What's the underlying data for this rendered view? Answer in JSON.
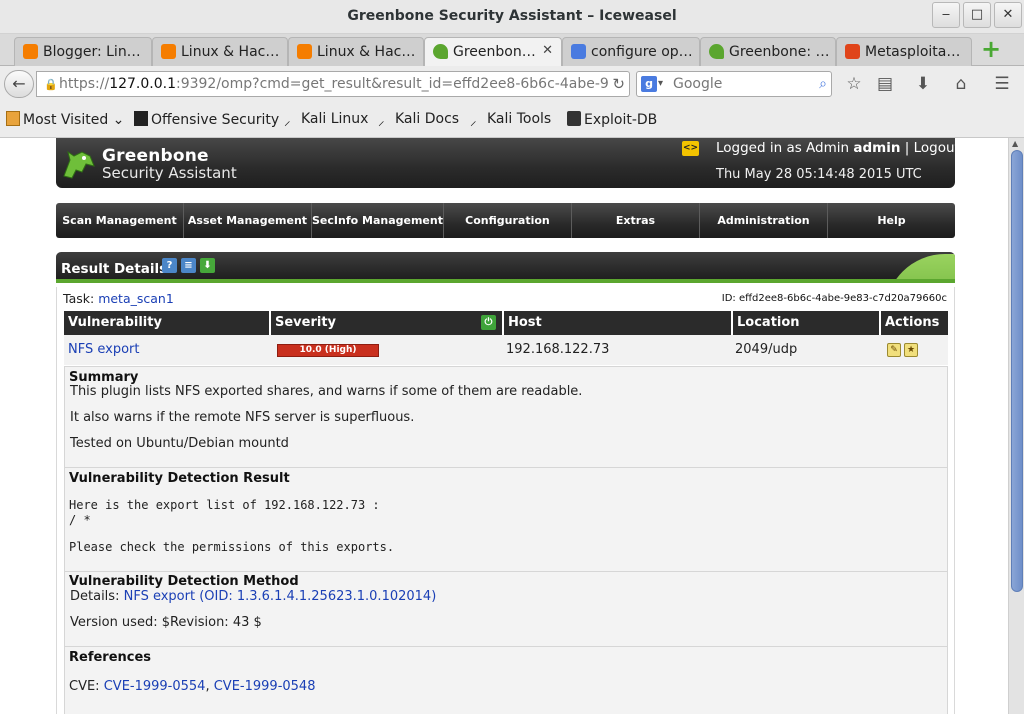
{
  "window": {
    "title": "Greenbone Security Assistant – Iceweasel"
  },
  "tabs": [
    {
      "label": "Blogger: Lin…",
      "icon_color": "#f57d00"
    },
    {
      "label": "Linux & Hac…",
      "icon_color": "#f57d00"
    },
    {
      "label": "Linux & Hac…",
      "icon_color": "#f57d00"
    },
    {
      "label": "Greenbon…",
      "icon_color": "#5ba62f"
    },
    {
      "label": "configure op…",
      "icon_color": "#4a7be0"
    },
    {
      "label": "Greenbone: …",
      "icon_color": "#5ba62f"
    },
    {
      "label": "Metasploita…",
      "icon_color": "#e0441a"
    }
  ],
  "tab_close": "✕",
  "nav": {
    "url_prefix": "https://",
    "url_host": "127.0.0.1",
    "url_rest": ":9392/omp?cmd=get_result&result_id=effd2ee8-6b6c-4abe-9",
    "search_placeholder": "Google"
  },
  "bookmarks": [
    {
      "label": "Most Visited",
      "icon": "folder-icon"
    },
    {
      "label": "Offensive Security",
      "icon": "offsec-icon"
    },
    {
      "label": "Kali Linux",
      "icon": "kali-dragon-icon"
    },
    {
      "label": "Kali Docs",
      "icon": "kali-dragon-icon"
    },
    {
      "label": "Kali Tools",
      "icon": "kali-dragon-icon"
    },
    {
      "label": "Exploit-DB",
      "icon": "exploitdb-icon"
    }
  ],
  "gsa": {
    "brand_line1": "Greenbone",
    "brand_line2": "Security Assistant",
    "lang_icon": "<>",
    "logged_in_prefix": "Logged in as Admin",
    "username": "admin",
    "separator": "|",
    "logout": "Logout",
    "datetime": "Thu May 28 05:14:48 2015 UTC"
  },
  "menu": [
    "Scan Management",
    "Asset Management",
    "SecInfo Management",
    "Configuration",
    "Extras",
    "Administration",
    "Help"
  ],
  "panel": {
    "title": "Result Details",
    "task_label": "Task:",
    "task_name": "meta_scan1",
    "id_label": "ID:",
    "id_value": "effd2ee8-6b6c-4abe-9e83-c7d20a79660c"
  },
  "result_table": {
    "headers": [
      "Vulnerability",
      "Severity",
      "Host",
      "Location",
      "Actions"
    ],
    "row": {
      "vulnerability": "NFS export",
      "severity": "10.0 (High)",
      "host": "192.168.122.73",
      "location": "2049/udp"
    }
  },
  "summary": {
    "title": "Summary",
    "line1": "This plugin lists NFS exported shares, and warns if some of them are readable.",
    "line2": "It also warns if the remote NFS server is superfluous.",
    "line3": "Tested on Ubuntu/Debian mountd"
  },
  "detection_result": {
    "title": "Vulnerability Detection Result",
    "line1": "Here is the export list of 192.168.122.73 :",
    "line2": "/ *",
    "line3": "Please check the permissions of this exports."
  },
  "detection_method": {
    "title": "Vulnerability Detection Method",
    "details_label": "Details:",
    "details_link": "NFS export (OID: 1.3.6.1.4.1.25623.1.0.102014)",
    "version": "Version used: $Revision: 43 $"
  },
  "references": {
    "title": "References",
    "cve_label": "CVE:",
    "cve1": "CVE-1999-0554",
    "comma": ",",
    "cve2": "CVE-1999-0548"
  },
  "colors": {
    "accent_green": "#5ba62f",
    "severity_high": "#c9301e",
    "link_blue": "#1a3fb5"
  }
}
